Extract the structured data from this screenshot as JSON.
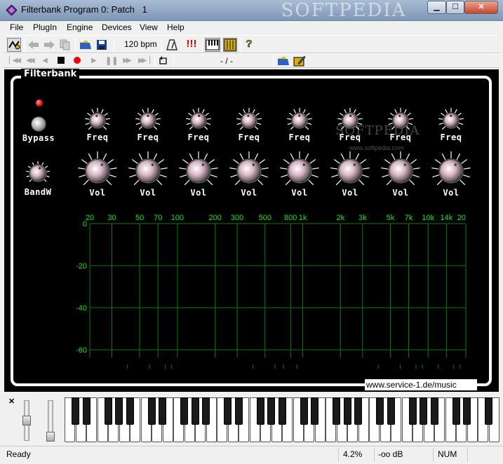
{
  "window": {
    "title": "Filterbank Program 0: Patch   1",
    "watermark": "SOFTPEDIA",
    "controls": {
      "minimize": "▁",
      "maximize": "☐",
      "close": "✕"
    }
  },
  "menu": [
    "File",
    "PlugIn",
    "Engine",
    "Devices",
    "View",
    "Help"
  ],
  "toolbar": {
    "bpm": "120 bpm",
    "position": "- / -",
    "icons": [
      "wizard-icon",
      "back-arrow-icon",
      "forward-arrow-icon",
      "copy-icon",
      "open-folder-icon",
      "save-icon",
      "metronome-icon",
      "alert-icon",
      "piano-icon",
      "panel-icon",
      "help-icon"
    ]
  },
  "transport": {
    "icons": [
      "rewind-start-icon",
      "rewind-icon",
      "prev-icon",
      "stop-icon",
      "record-icon",
      "play-icon",
      "pause-icon",
      "fast-forward-icon",
      "forward-end-icon",
      "loop-icon",
      "open-folder-icon",
      "edit-icon"
    ]
  },
  "plugin": {
    "title": "Filterbank",
    "bypass_label": "Bypass",
    "bandwidth_label": "BandW",
    "freq_label": "Freq",
    "vol_label": "Vol",
    "band_count": 8,
    "website": "www.service-1.de/music",
    "watermark": "SOFTPEDIA",
    "watermark_url": "www.softpedia.com",
    "colors": {
      "background": "#000000",
      "frame": "#ffffff",
      "grid": "#0d7a0d",
      "grid_label": "#22dd22"
    }
  },
  "graph": {
    "freq_ticks": [
      "20",
      "30",
      "50",
      "70",
      "100",
      "200",
      "300",
      "500",
      "800",
      "1k",
      "2k",
      "3k",
      "5k",
      "7k",
      "10k",
      "14k",
      "20"
    ],
    "db_ticks": [
      "0",
      "-20",
      "-40",
      "-60"
    ]
  },
  "status": {
    "text": "Ready",
    "cpu": "4.2%",
    "level": "-oo dB",
    "num": "NUM"
  }
}
